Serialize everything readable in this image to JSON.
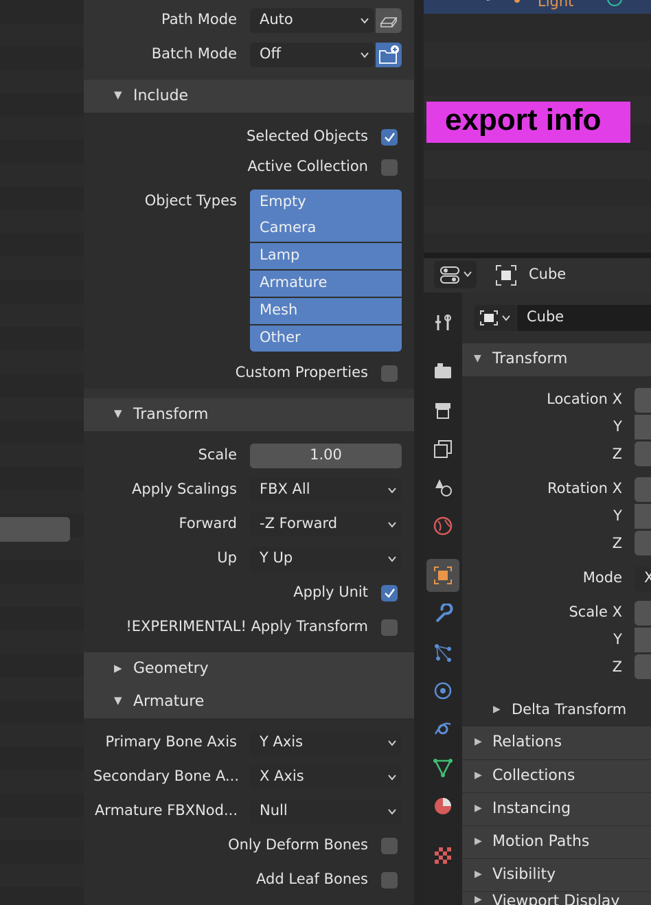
{
  "export_panel": {
    "path_mode": {
      "label": "Path Mode",
      "value": "Auto"
    },
    "batch_mode": {
      "label": "Batch Mode",
      "value": "Off"
    },
    "include": {
      "title": "Include",
      "selected_objects": {
        "label": "Selected Objects",
        "checked": true
      },
      "active_collection": {
        "label": "Active Collection",
        "checked": false
      },
      "object_types_label": "Object Types",
      "object_types": [
        "Empty",
        "Camera",
        "Lamp",
        "Armature",
        "Mesh",
        "Other"
      ],
      "custom_properties": {
        "label": "Custom Properties",
        "checked": false
      }
    },
    "transform": {
      "title": "Transform",
      "scale": {
        "label": "Scale",
        "value": "1.00"
      },
      "apply_scalings": {
        "label": "Apply Scalings",
        "value": "FBX All"
      },
      "forward": {
        "label": "Forward",
        "value": "-Z Forward"
      },
      "up": {
        "label": "Up",
        "value": "Y Up"
      },
      "apply_unit": {
        "label": "Apply Unit",
        "checked": true
      },
      "apply_transform": {
        "label": "!EXPERIMENTAL! Apply Transform",
        "checked": false
      }
    },
    "geometry": {
      "title": "Geometry"
    },
    "armature": {
      "title": "Armature",
      "primary_bone_axis": {
        "label": "Primary Bone Axis",
        "value": "Y Axis"
      },
      "secondary_bone_axis": {
        "label": "Secondary Bone A...",
        "value": "X Axis"
      },
      "armature_node_type": {
        "label": "Armature FBXNod...",
        "value": "Null"
      },
      "only_deform_bones": {
        "label": "Only Deform Bones",
        "checked": false
      },
      "add_leaf_bones": {
        "label": "Add Leaf Bones",
        "checked": false
      }
    }
  },
  "annotation": {
    "text": "export info"
  },
  "viewport": {
    "light_label": "Light"
  },
  "properties": {
    "header_object": "Cube",
    "object_name": "Cube",
    "transform_title": "Transform",
    "location": [
      "Location X",
      "Y",
      "Z"
    ],
    "rotation": [
      "Rotation X",
      "Y",
      "Z"
    ],
    "mode_label": "Mode",
    "mode_value": "X",
    "scale": [
      "Scale X",
      "Y",
      "Z"
    ],
    "delta_transform": "Delta Transform",
    "sections": [
      "Relations",
      "Collections",
      "Instancing",
      "Motion Paths",
      "Visibility",
      "Viewport Display"
    ]
  },
  "colors": {
    "accent": "#4772b3",
    "annotation": "#e23ee8",
    "object_tab": "#e8954a"
  }
}
